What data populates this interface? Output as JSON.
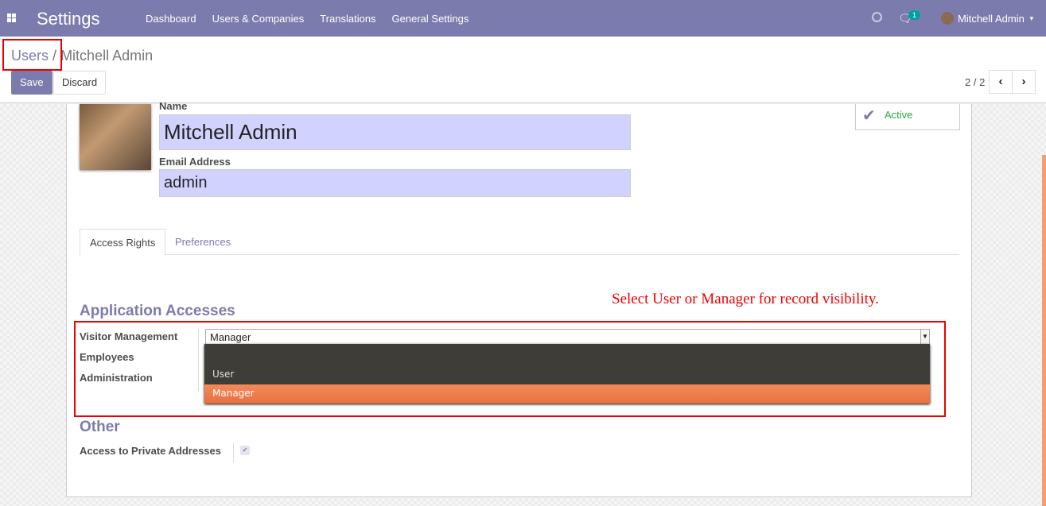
{
  "navbar": {
    "brand": "Settings",
    "menu": [
      "Dashboard",
      "Users & Companies",
      "Translations",
      "General Settings"
    ],
    "chat_count": "1",
    "user": "Mitchell Admin"
  },
  "breadcrumb": {
    "parent": "Users",
    "separator": "/",
    "current": "Mitchell Admin"
  },
  "buttons": {
    "save": "Save",
    "discard": "Discard"
  },
  "pager": {
    "value": "2 / 2"
  },
  "form": {
    "name_label": "Name",
    "name": "Mitchell Admin",
    "email_label": "Email Address",
    "email": "admin",
    "active_label": "Active"
  },
  "tabs": [
    "Access Rights",
    "Preferences"
  ],
  "annotation": "Select User or Manager for record visibility.",
  "app_accesses": {
    "title": "Application Accesses",
    "fields": [
      "Visitor Management",
      "Employees",
      "Administration"
    ],
    "selected": "Manager",
    "options": [
      "",
      "User",
      "Manager"
    ]
  },
  "other": {
    "title": "Other",
    "field": "Access to Private Addresses",
    "checked": true
  },
  "colors": {
    "brand": "#7c7bad",
    "highlight": "#e6703f",
    "annotation": "#ee0000"
  }
}
